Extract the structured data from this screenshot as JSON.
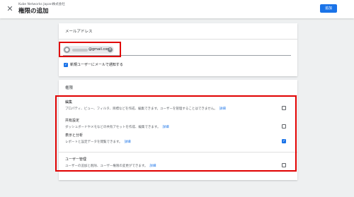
{
  "header": {
    "close_icon": "close-icon",
    "account_name": "Kube Networks Japan株式会社",
    "title": "権限の追加",
    "save_label": "追加"
  },
  "email_section": {
    "heading": "メールアドレス",
    "chip": {
      "avatar_icon": "person-icon",
      "email_suffix": "@gmail.com",
      "remove_icon": "remove-chip-icon"
    },
    "notify": {
      "label": "新規ユーザーにメールで通知する",
      "checked": true
    }
  },
  "permissions_section": {
    "heading": "権限",
    "link_label": "詳細",
    "items": [
      {
        "title": "編集",
        "description": "プロパティ、ビュー、フィルタ、目標などを作成、編集できます。ユーザーを管理することはできません。",
        "checked": false
      },
      {
        "title": "共有設定",
        "description": "ダッシュボードやメモなどの共有アセットを作成、編集できます。",
        "checked": false
      },
      {
        "title": "表示と分析",
        "description": "レポートと設定データを閲覧できます。",
        "checked": true
      },
      {
        "title": "ユーザー管理",
        "description": "ユーザーの追加と削除、ユーザー権限の変更ができます。",
        "checked": false
      }
    ]
  },
  "colors": {
    "accent": "#1a73e8",
    "highlight": "#e00000",
    "background": "#eef0f1"
  }
}
